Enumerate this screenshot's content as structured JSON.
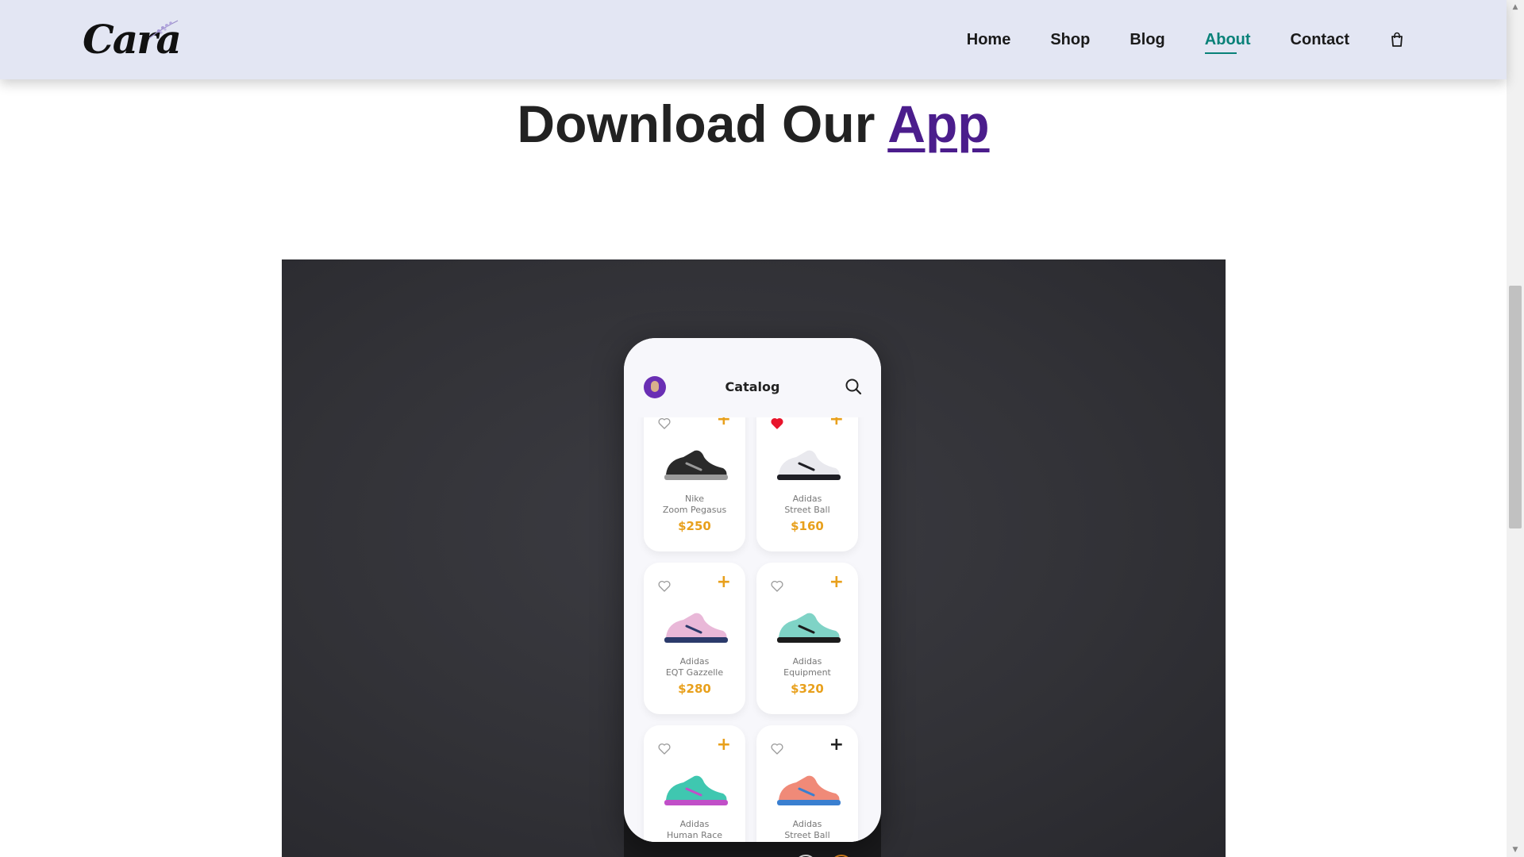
{
  "header": {
    "logo_text": "Cara",
    "nav": [
      {
        "label": "Home",
        "active": false
      },
      {
        "label": "Shop",
        "active": false
      },
      {
        "label": "Blog",
        "active": false
      },
      {
        "label": "About",
        "active": true
      },
      {
        "label": "Contact",
        "active": false
      }
    ],
    "cart_icon": "shopping-bag-icon"
  },
  "section": {
    "heading_prefix": "Download Our",
    "heading_link": "App"
  },
  "app": {
    "title": "Catalog",
    "products": [
      {
        "brand": "Nike",
        "model": "Zoom Pegasus",
        "price": "$250",
        "favorite": false,
        "plus_dark": false,
        "shoe_color": "#2a2a2a",
        "accent": "#9a9a9a"
      },
      {
        "brand": "Adidas",
        "model": "Street Ball",
        "price": "$160",
        "favorite": true,
        "plus_dark": false,
        "shoe_color": "#e9e9ee",
        "accent": "#1f1f25"
      },
      {
        "brand": "Adidas",
        "model": "EQT Gazzelle",
        "price": "$280",
        "favorite": false,
        "plus_dark": false,
        "shoe_color": "#e9b8d8",
        "accent": "#2b3a6b"
      },
      {
        "brand": "Adidas",
        "model": "Equipment",
        "price": "$320",
        "favorite": false,
        "plus_dark": false,
        "shoe_color": "#7fd3c6",
        "accent": "#1b1b1b"
      },
      {
        "brand": "Adidas",
        "model": "Human Race",
        "price": "",
        "favorite": false,
        "plus_dark": false,
        "shoe_color": "#3fc7b0",
        "accent": "#c14fc8"
      },
      {
        "brand": "Adidas",
        "model": "Street Ball",
        "price": "",
        "favorite": false,
        "plus_dark": true,
        "shoe_color": "#f08a78",
        "accent": "#3a7fd0"
      }
    ]
  },
  "colors": {
    "header_bg": "#e3e6f3",
    "active_nav": "#088178",
    "heading_link": "#4b1d8c",
    "price": "#e8a01c",
    "heart_filled": "#e8142c"
  }
}
